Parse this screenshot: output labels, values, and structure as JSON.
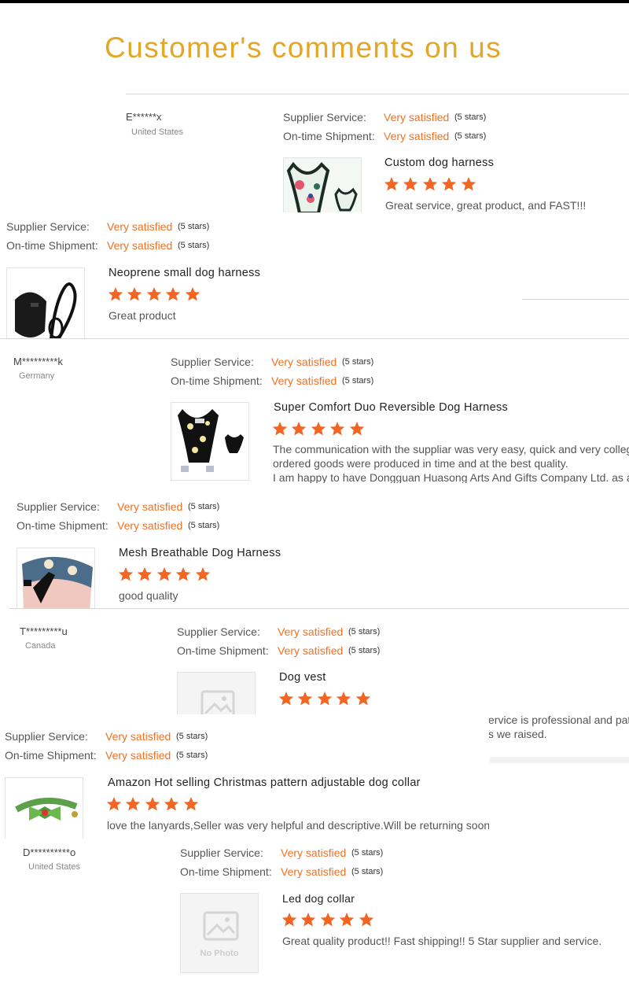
{
  "header": {
    "title": "Customer's comments on us"
  },
  "labels": {
    "supplier_service": "Supplier Service:",
    "ontime_shipment": "On-time Shipment:",
    "very_satisfied": "Very satisfied",
    "five_stars": "(5 stars)",
    "no_photo": "No Photo"
  },
  "reviews": [
    {
      "buyer": "E******x",
      "country": "United States",
      "product": "Custom dog harness",
      "rating": 5,
      "comment": [
        "Great service, great product, and FAST!!!"
      ]
    },
    {
      "buyer": "",
      "country": "",
      "product": "Neoprene small dog harness",
      "rating": 5,
      "comment": [
        "Great product"
      ]
    },
    {
      "buyer": "M*********k",
      "country": "Germany",
      "product": "Super Comfort Duo Reversible Dog Harness",
      "rating": 5,
      "comment": [
        "The communication with the suppliar was very easy, quick and very collegia",
        "ordered goods were produced in time and at the best quality.",
        "I am happy to have Dongguan Huasong Arts And Gifts Company Ltd. as a p"
      ]
    },
    {
      "buyer": "",
      "country": "",
      "product": "Mesh Breathable Dog Harness",
      "rating": 5,
      "comment": [
        "good quality"
      ]
    },
    {
      "buyer": "T*********u",
      "country": "Canada",
      "product": "Dog vest",
      "rating": 5,
      "comment": [
        "ervice is professional and pati",
        "s we raised."
      ]
    },
    {
      "buyer": "",
      "country": "",
      "product": "Amazon Hot selling Christmas pattern adjustable dog collar",
      "rating": 5,
      "comment": [
        "love the lanyards,Seller was very helpful and descriptive.Will be returning soon"
      ]
    },
    {
      "buyer": "D**********o",
      "country": "United States",
      "product": "Led dog collar",
      "rating": 5,
      "comment": [
        "Great quality product!! Fast shipping!! 5 Star supplier and service."
      ]
    }
  ],
  "icons": {
    "star": "star-icon",
    "no_photo": "image-placeholder-icon"
  },
  "colors": {
    "title": "#e3a627",
    "accent": "#f07122",
    "star": "#f26522"
  }
}
